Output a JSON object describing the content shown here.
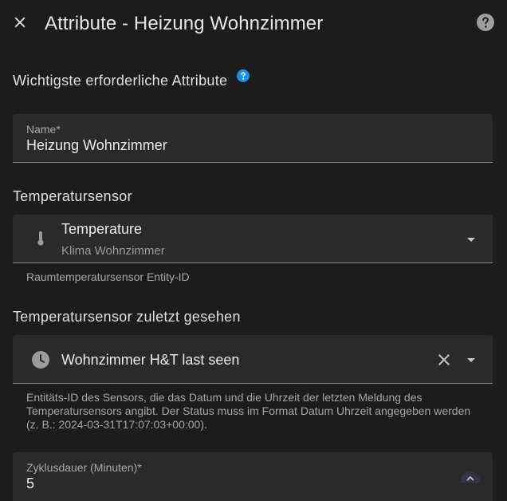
{
  "header": {
    "title": "Attribute - Heizung Wohnzimmer",
    "close_icon": "close-icon",
    "help_icon": "help-circle-icon"
  },
  "section_required": {
    "label": "Wichtigste erforderliche Attribute",
    "info_icon": "help-circle-icon",
    "info_color": "#1a8fe3"
  },
  "name_field": {
    "label": "Name*",
    "value": "Heizung Wohnzimmer"
  },
  "temp_sensor": {
    "section_label": "Temperatursensor",
    "icon": "thermometer-icon",
    "primary": "Temperature",
    "secondary": "Klima Wohnzimmer",
    "helper": "Raumtemperatursensor Entity-ID"
  },
  "last_seen": {
    "section_label": "Temperatursensor zuletzt gesehen",
    "icon": "clock-icon",
    "value": "Wohnzimmer H&T last seen",
    "helper": "Entitäts-ID des Sensors, die das Datum und die Uhrzeit der letzten Meldung des Temperatursensors angibt. Der Status muss im Format Datum Uhrzeit angegeben werden (z. B.: 2024-03-31T17:07:03+00:00)."
  },
  "cycle_field": {
    "label": "Zyklusdauer (Minuten)*",
    "value": "5"
  },
  "colors": {
    "background": "#1c1c1c",
    "field_background": "#2a2a2a",
    "accent": "#1a8fe3"
  }
}
